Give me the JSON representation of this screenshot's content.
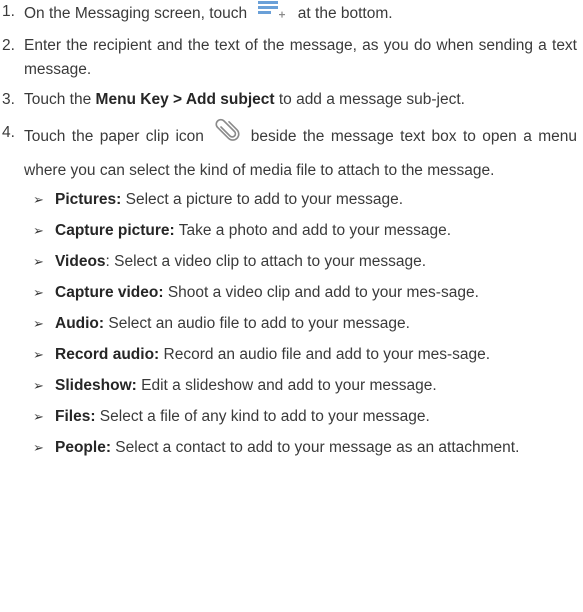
{
  "steps": [
    {
      "num": "1.",
      "before": "On the Messaging screen, touch",
      "icon": "compose-message-icon",
      "after": "at the bottom."
    },
    {
      "num": "2.",
      "text": "Enter the recipient and the text of the message, as you do when sending a text message."
    },
    {
      "num": "3.",
      "before": "Touch the ",
      "bold": "Menu Key > Add subject",
      "after": " to add a message sub-ject."
    },
    {
      "num": "4.",
      "before": "Touch the paper clip icon",
      "icon": "paperclip-icon",
      "after": "beside the message text box to open a menu where you can select the kind of media file to attach to the message."
    }
  ],
  "bullets": [
    {
      "term": "Pictures:",
      "desc": " Select a picture to add to your message."
    },
    {
      "term": "Capture picture:",
      "desc": " Take a photo and add to your message."
    },
    {
      "term": "Videos",
      "desc": ": Select a video clip to attach to your message."
    },
    {
      "term": "Capture video:",
      "desc": " Shoot a video clip and add to your mes-sage."
    },
    {
      "term": "Audio:",
      "desc": " Select an audio file to add to your message."
    },
    {
      "term": "Record audio:",
      "desc": " Record an audio file and add to your mes-sage."
    },
    {
      "term": "Slideshow:",
      "desc": " Edit a slideshow and add to your message."
    },
    {
      "term": "Files:",
      "desc": " Select a file of any kind to add to your message."
    },
    {
      "term": "People:",
      "desc": " Select a contact to add to your message as an attachment."
    }
  ],
  "bullet_marker": "➢",
  "colors": {
    "text": "#3a3a3a",
    "icon_blue": "#6aa0d8",
    "icon_gray": "#8a8a8a"
  }
}
